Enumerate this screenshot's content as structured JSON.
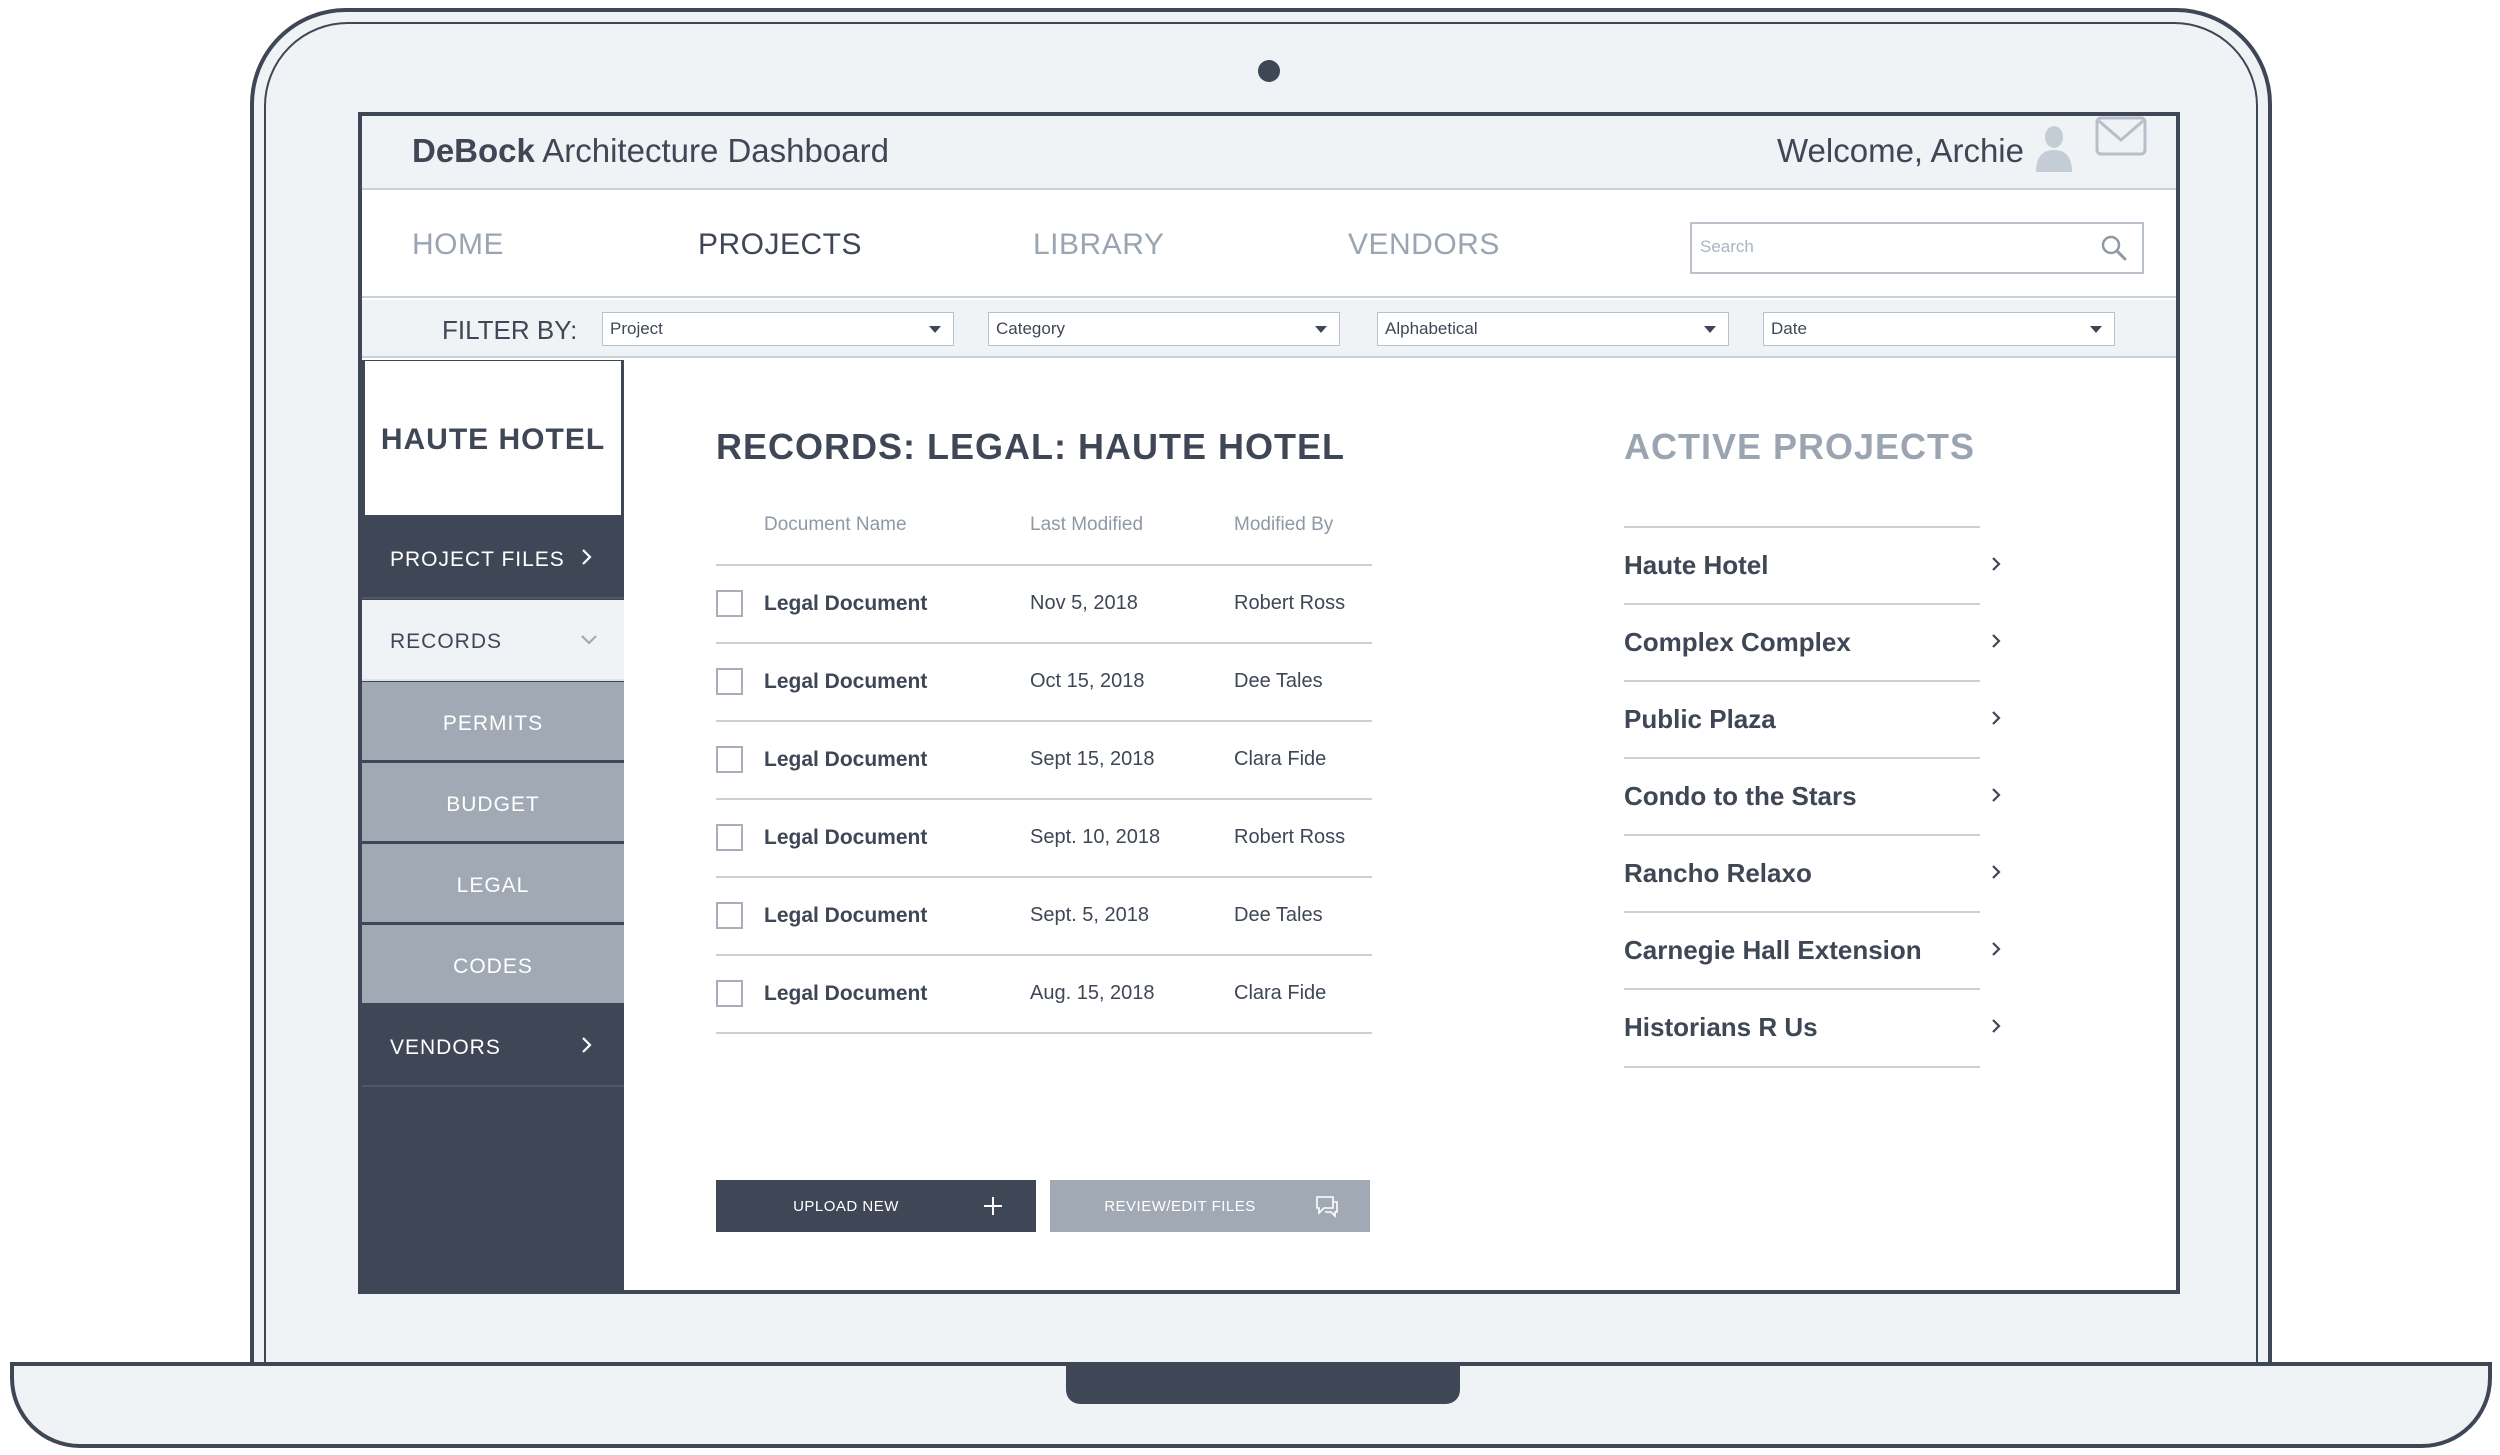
{
  "header": {
    "brand_bold": "DeBock",
    "brand_rest": " Architecture Dashboard",
    "welcome": "Welcome, Archie",
    "user_icon": "user-icon",
    "mail_icon": "mail-icon"
  },
  "nav": {
    "items": [
      {
        "label": "HOME",
        "active": false
      },
      {
        "label": "PROJECTS",
        "active": true
      },
      {
        "label": "LIBRARY",
        "active": false
      },
      {
        "label": "VENDORS",
        "active": false
      }
    ],
    "search_placeholder": "Search",
    "search_icon": "search-icon"
  },
  "filters": {
    "label": "FILTER BY:",
    "selects": [
      {
        "value": "Project"
      },
      {
        "value": "Category"
      },
      {
        "value": "Alphabetical"
      },
      {
        "value": "Date"
      }
    ]
  },
  "sidebar": {
    "title": "HAUTE HOTEL",
    "items": [
      {
        "label": "PROJECT FILES",
        "icon": "chevron-right-icon"
      },
      {
        "label": "RECORDS",
        "icon": "chevron-down-icon"
      },
      {
        "label": "PERMITS"
      },
      {
        "label": "BUDGET"
      },
      {
        "label": "LEGAL"
      },
      {
        "label": "CODES"
      },
      {
        "label": "VENDORS",
        "icon": "chevron-right-icon"
      }
    ]
  },
  "records": {
    "title": "RECORDS: LEGAL: HAUTE HOTEL",
    "columns": [
      "Document Name",
      "Last Modified",
      "Modified By"
    ],
    "rows": [
      {
        "name": "Legal Document",
        "date": "Nov 5, 2018",
        "by": "Robert Ross"
      },
      {
        "name": "Legal Document",
        "date": "Oct 15, 2018",
        "by": "Dee Tales"
      },
      {
        "name": "Legal Document",
        "date": "Sept 15, 2018",
        "by": "Clara Fide"
      },
      {
        "name": "Legal Document",
        "date": "Sept. 10, 2018",
        "by": "Robert Ross"
      },
      {
        "name": "Legal Document",
        "date": "Sept. 5, 2018",
        "by": "Dee Tales"
      },
      {
        "name": "Legal Document",
        "date": "Aug. 15, 2018",
        "by": "Clara Fide"
      }
    ],
    "upload_label": "UPLOAD NEW",
    "review_label": "REVIEW/EDIT FILES"
  },
  "active_projects": {
    "title": "ACTIVE PROJECTS",
    "items": [
      "Haute Hotel",
      "Complex Complex",
      "Public Plaza",
      "Condo to the Stars",
      "Rancho Relaxo",
      "Carnegie Hall Extension",
      "Historians R Us"
    ]
  },
  "colors": {
    "dark": "#3f4756",
    "muted": "#a1aab4",
    "light": "#f0f3f6"
  }
}
